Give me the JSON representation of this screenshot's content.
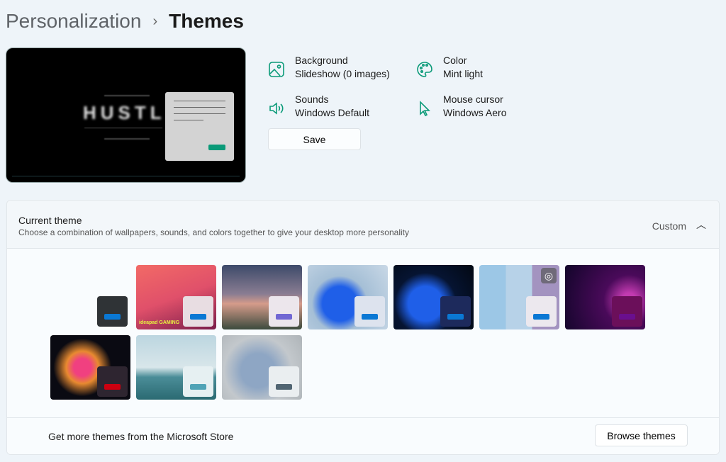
{
  "breadcrumb": {
    "parent": "Personalization",
    "separator": "›",
    "current": "Themes"
  },
  "preview": {
    "wallpaper_text": "HUSTLE",
    "accent": "#0a9a78"
  },
  "info": [
    {
      "icon": "image-icon",
      "label": "Background",
      "value": "Slideshow (0 images)"
    },
    {
      "icon": "palette-icon",
      "label": "Color",
      "value": "Mint light"
    },
    {
      "icon": "speaker-icon",
      "label": "Sounds",
      "value": "Windows Default"
    },
    {
      "icon": "cursor-icon",
      "label": "Mouse cursor",
      "value": "Windows Aero"
    }
  ],
  "save_label": "Save",
  "current_theme": {
    "title": "Current theme",
    "description": "Choose a combination of wallpapers, sounds, and colors together to give your desktop more personality",
    "value": "Custom",
    "expanded": true
  },
  "themes": [
    {
      "name": "custom",
      "card": "#2f3336",
      "accent": "#0a78d4"
    },
    {
      "name": "ideapad-gaming",
      "card": "#e8dde2",
      "accent": "#0a78d4",
      "logo": "ideapad GAMING"
    },
    {
      "name": "milky-way",
      "card": "#ece6ec",
      "accent": "#7167d3"
    },
    {
      "name": "windows-light",
      "card": "#dde3ee",
      "accent": "#0a78d4"
    },
    {
      "name": "windows-dark",
      "card": "#1d2a5c",
      "accent": "#0a78d4"
    },
    {
      "name": "spotlight",
      "card": "#ece8ee",
      "accent": "#0a78d4"
    },
    {
      "name": "glow",
      "card": "#6b0f5a",
      "accent": "#6a0f8e"
    },
    {
      "name": "captured-motion",
      "card": "#2e2530",
      "accent": "#cc0010"
    },
    {
      "name": "sunrise",
      "card": "#e6f0f2",
      "accent": "#4fa3b6"
    },
    {
      "name": "flow",
      "card": "#eaeef0",
      "accent": "#516572"
    }
  ],
  "footer": {
    "text": "Get more themes from the Microsoft Store",
    "button": "Browse themes"
  }
}
